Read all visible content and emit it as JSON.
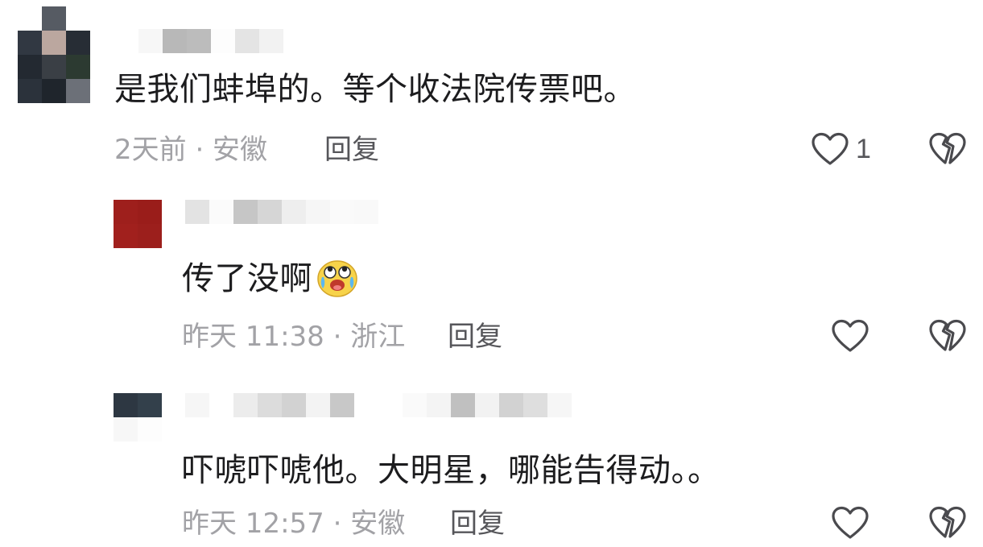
{
  "comments": [
    {
      "text": "是我们蚌埠的。等个收法院传票吧。",
      "meta": "2天前 · 安徽",
      "reply_label": "回复",
      "like_count": "1"
    },
    {
      "text": "传了没啊",
      "emoji": "crying-laughing-emoji",
      "meta": "昨天 11:38 · 浙江",
      "reply_label": "回复",
      "like_count": ""
    },
    {
      "text": "吓唬吓唬他。大明星，哪能告得动。。",
      "meta": "昨天 12:57 · 安徽",
      "reply_label": "回复",
      "like_count": ""
    }
  ],
  "icons": {
    "like": "heart-outline-icon",
    "dislike": "broken-heart-icon"
  },
  "colors": {
    "text_primary": "#1c1c1e",
    "text_meta": "#a2a2a6",
    "reply": "#56565a",
    "icon": "#4a4a4e"
  }
}
